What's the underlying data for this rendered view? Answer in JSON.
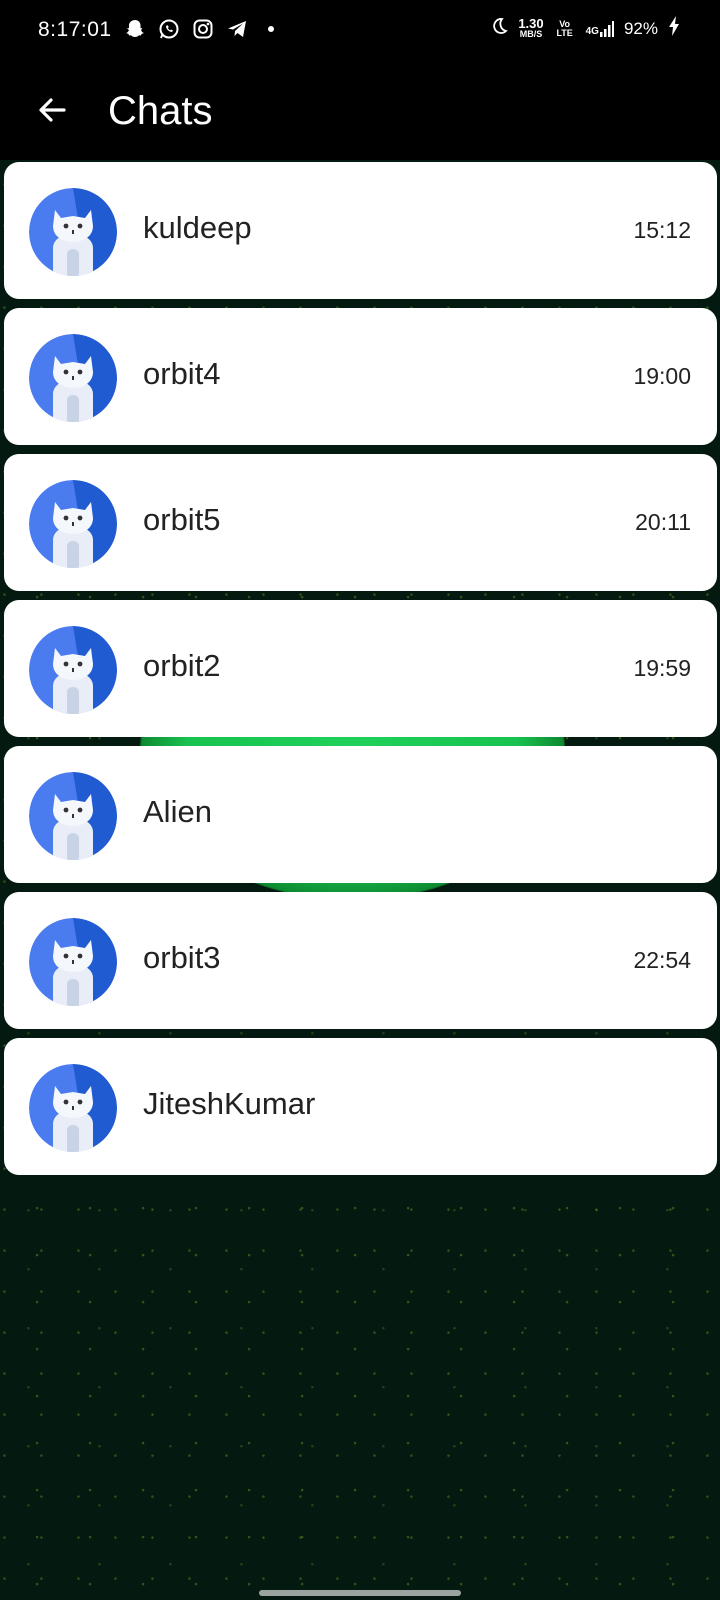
{
  "status_bar": {
    "time": "8:17:01",
    "net_speed": "1.30",
    "net_unit": "MB/S",
    "volte": "Vo LTE",
    "signal": "4G",
    "battery": "92%",
    "icons": [
      "snapchat-icon",
      "whatsapp-icon",
      "instagram-icon",
      "telegram-icon",
      "dot-icon",
      "moon-icon",
      "wifi-signal-icon",
      "battery-charging-icon"
    ]
  },
  "header": {
    "title": "Chats",
    "back_icon": "arrow-left-icon"
  },
  "chats": [
    {
      "name": "kuldeep",
      "time": "15:12"
    },
    {
      "name": "orbit4",
      "time": "19:00"
    },
    {
      "name": "orbit5",
      "time": "20:11"
    },
    {
      "name": "orbit2",
      "time": "19:59"
    },
    {
      "name": "Alien",
      "time": ""
    },
    {
      "name": "orbit3",
      "time": "22:54"
    },
    {
      "name": "JiteshKumar",
      "time": ""
    }
  ],
  "colors": {
    "header_bg": "#000000",
    "background": "#041a10",
    "avatar_blue": "#4a7cf0",
    "avatar_dark_blue": "#1552c9",
    "card_bg": "#ffffff",
    "glow_green": "#1fd15a"
  }
}
